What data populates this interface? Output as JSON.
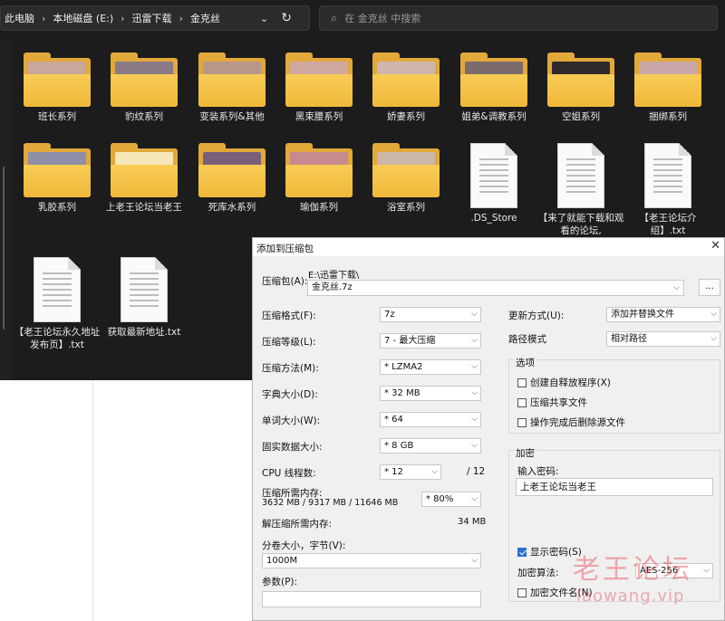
{
  "explorer": {
    "breadcrumb": [
      "此电脑",
      "本地磁盘 (E:)",
      "迅雷下载",
      "金克丝"
    ],
    "breadcrumb_sep": "›",
    "dropdown_icon": "⌄",
    "refresh_icon": "↻",
    "search_placeholder": "在 金克丝 中搜索",
    "search_icon": "⌕",
    "items": [
      {
        "label": "班长系列",
        "kind": "folder",
        "photo": "#c8a89a"
      },
      {
        "label": "豹纹系列",
        "kind": "folder",
        "photo": "#8a7a86"
      },
      {
        "label": "变装系列&其他",
        "kind": "folder",
        "photo": "#b89888"
      },
      {
        "label": "黑束腰系列",
        "kind": "folder",
        "photo": "#d0a8a0"
      },
      {
        "label": "娇妻系列",
        "kind": "folder",
        "photo": "#cfb6ad"
      },
      {
        "label": "姐弟&调教系列",
        "kind": "folder",
        "photo": "#7c6a6c"
      },
      {
        "label": "空姐系列",
        "kind": "folder",
        "photo": "#2e2a2c"
      },
      {
        "label": "捆绑系列",
        "kind": "folder",
        "photo": "#c9a7a8"
      },
      {
        "label": "乳胶系列",
        "kind": "folder",
        "photo": "#8d8fa8"
      },
      {
        "label": "上老王论坛当老王",
        "kind": "folder",
        "photo": "#f6e6b8"
      },
      {
        "label": "死库水系列",
        "kind": "folder",
        "photo": "#7b5f7a"
      },
      {
        "label": "瑜伽系列",
        "kind": "folder",
        "photo": "#c58a8e"
      },
      {
        "label": "浴室系列",
        "kind": "folder",
        "photo": "#cdb7a8"
      },
      {
        "label": ".DS_Store",
        "kind": "file"
      },
      {
        "label": "【来了就能下载和观看的论坛,",
        "kind": "file"
      },
      {
        "label": "【老王论坛介绍】.txt",
        "kind": "file"
      },
      {
        "label": "【老王论坛永久地址发布页】.txt",
        "kind": "file"
      },
      {
        "label": "获取最新地址.txt",
        "kind": "file"
      }
    ]
  },
  "dialog": {
    "title": "添加到压缩包",
    "close_icon": "✕",
    "archive_label": "压缩包(A):",
    "archive_dir": "E:\\迅雷下载\\",
    "archive_name": "金克丝.7z",
    "browse_label": "...",
    "dropdown_arrow": "⌵",
    "format_label": "压缩格式(F):",
    "format_value": "7z",
    "level_label": "压缩等级(L):",
    "level_value": "7 - 最大压缩",
    "method_label": "压缩方法(M):",
    "method_value": "*  LZMA2",
    "dict_label": "字典大小(D):",
    "dict_value": "*  32 MB",
    "word_label": "单词大小(W):",
    "word_value": "*  64",
    "solid_label": "固实数据大小:",
    "solid_value": "*  8 GB",
    "cpu_label": "CPU 线程数:",
    "cpu_value": "*  12",
    "cpu_total": "/ 12",
    "mem_label": "压缩所需内存:",
    "mem_detail": "3632 MB / 9317 MB / 11646 MB",
    "mem_percent": "*  80%",
    "decomp_label": "解压缩所需内存:",
    "decomp_value": "34 MB",
    "split_label": "分卷大小，字节(V):",
    "split_value": "1000M",
    "params_label": "参数(P):",
    "params_value": "",
    "update_label": "更新方式(U):",
    "update_value": "添加并替换文件",
    "pathmode_label": "路径模式",
    "pathmode_value": "相对路径",
    "options_title": "选项",
    "opt_sfx": "创建自释放程序(X)",
    "opt_shared": "压缩共享文件",
    "opt_delete": "操作完成后删除源文件",
    "encrypt_title": "加密",
    "password_label": "输入密码:",
    "password_value": "上老王论坛当老王",
    "show_password": "显示密码(S)",
    "enc_method_label": "加密算法:",
    "enc_method_value": "AES-256",
    "encrypt_names": "加密文件名(N)"
  },
  "watermark": {
    "cn": "老王论坛",
    "url": "laowang.vip"
  },
  "colors": {
    "folder": "#f0b83a",
    "explorer_bg": "#1c1c1c",
    "checkbox_accent": "#2b6fd0",
    "watermark": "#e63c46"
  }
}
